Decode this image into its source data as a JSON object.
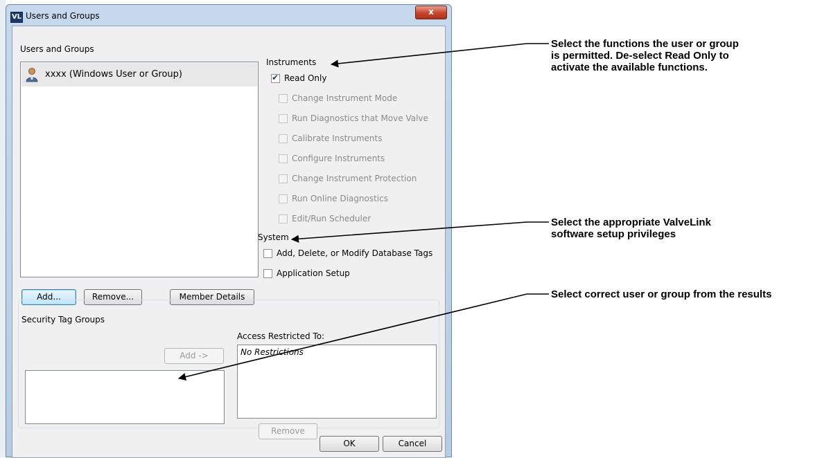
{
  "window": {
    "title": "Users and Groups",
    "app_icon_text": "VL",
    "close_glyph": "x"
  },
  "users_section": {
    "label": "Users and Groups",
    "selected_user": "xxxx (Windows User or Group)"
  },
  "instruments": {
    "label": "Instruments",
    "read_only": {
      "label": "Read Only",
      "checked": true
    },
    "functions": [
      "Change Instrument Mode",
      "Run Diagnostics that Move Valve",
      "Calibrate Instruments",
      "Configure Instruments",
      "Change Instrument Protection",
      "Run Online Diagnostics",
      "Edit/Run Scheduler"
    ]
  },
  "system": {
    "label": "System",
    "options": [
      "Add, Delete, or Modify Database Tags",
      "Application Setup"
    ]
  },
  "buttons": {
    "add": "Add...",
    "remove": "Remove...",
    "member_details": "Member Details",
    "tag_add": "Add ->",
    "tag_remove": "Remove",
    "ok": "OK",
    "cancel": "Cancel"
  },
  "security_tags": {
    "label": "Security Tag Groups",
    "access_label": "Access Restricted To:",
    "access_value": "No Restrictions"
  },
  "annotations": {
    "functions_line1": "Select the functions the user or group",
    "functions_line2": "is permitted. De-select Read Only to",
    "functions_line3": "activate the available functions.",
    "system_line1": "Select the appropriate ValveLink",
    "system_line2": "software setup privileges",
    "results": "Select correct user or group from the results"
  }
}
